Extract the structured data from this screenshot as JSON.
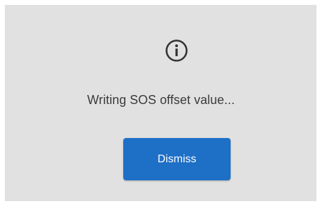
{
  "dialog": {
    "icon": "info-circle-icon",
    "message": "Writing SOS offset value...",
    "dismiss_label": "Dismiss"
  },
  "colors": {
    "background": "#e1e1e1",
    "button": "#1e6fc6",
    "text": "#3a3a3a"
  }
}
